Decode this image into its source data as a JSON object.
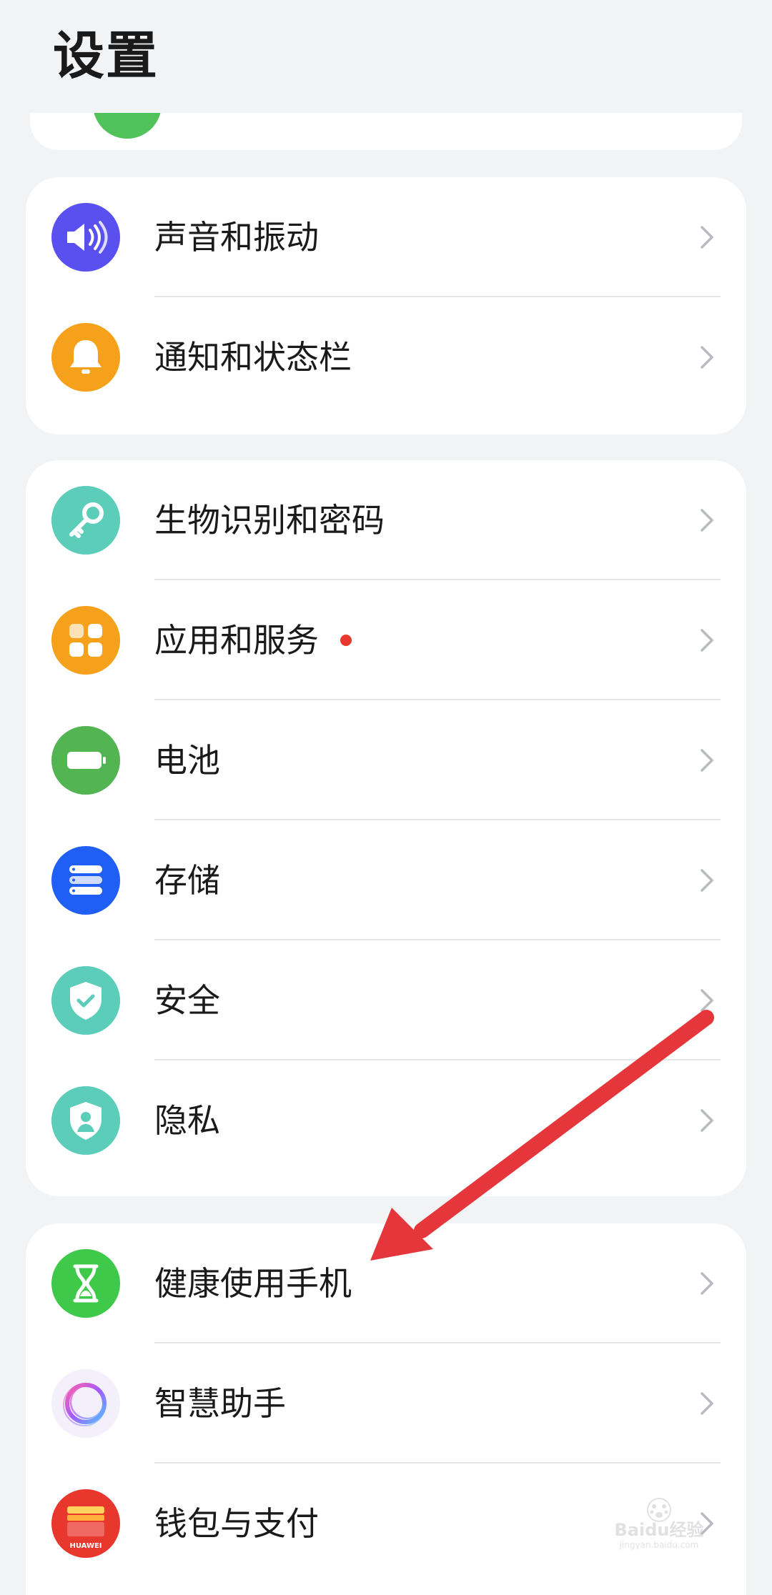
{
  "header": {
    "title": "设置"
  },
  "groups": [
    {
      "items": [
        {
          "label": "声音和振动",
          "icon": "speaker-icon",
          "color": "#5a50f0"
        },
        {
          "label": "通知和状态栏",
          "icon": "bell-icon",
          "color": "#f5a11c"
        }
      ]
    },
    {
      "items": [
        {
          "label": "生物识别和密码",
          "icon": "key-icon",
          "color": "#5ccdb9"
        },
        {
          "label": "应用和服务",
          "icon": "apps-grid-icon",
          "color": "#f5a11c",
          "badge": true,
          "badge_color": "#e8372d"
        },
        {
          "label": "电池",
          "icon": "battery-icon",
          "color": "#52b552"
        },
        {
          "label": "存储",
          "icon": "storage-icon",
          "color": "#1f5ff5"
        },
        {
          "label": "安全",
          "icon": "shield-check-icon",
          "color": "#5ccdb9"
        },
        {
          "label": "隐私",
          "icon": "privacy-shield-icon",
          "color": "#5ccdb9"
        }
      ]
    },
    {
      "items": [
        {
          "label": "健康使用手机",
          "icon": "hourglass-icon",
          "color": "#3fc94a"
        },
        {
          "label": "智慧助手",
          "icon": "assistant-ring-icon",
          "color": "#f4f0fb"
        },
        {
          "label": "钱包与支付",
          "icon": "wallet-icon",
          "color": "#e8372d",
          "icon_text": "HUAWEI"
        }
      ]
    }
  ],
  "annotation": {
    "icon": "red-arrow-icon",
    "color": "#e5363c"
  },
  "watermark": {
    "icon": "baidu-paw-icon",
    "text": "Baidu经验",
    "subtext": "jingyan.baidu.com"
  }
}
